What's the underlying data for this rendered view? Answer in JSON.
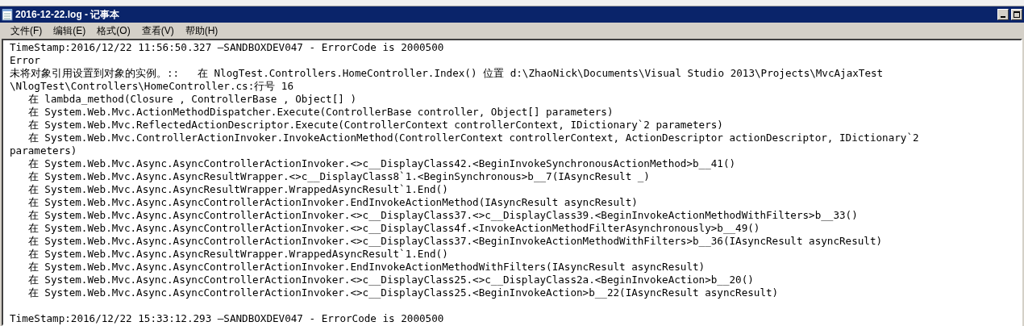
{
  "window": {
    "title": "2016-12-22.log - 记事本"
  },
  "menu": [
    "文件(F)",
    "编辑(E)",
    "格式(O)",
    "查看(V)",
    "帮助(H)"
  ],
  "log_entries": [
    {
      "lines": [
        "TimeStamp:2016/12/22 11:56:50.327 —SANDBOXDEV047 - ErrorCode is 2000500",
        "Error",
        "未将对象引用设置到对象的实例。::   在 NlogTest.Controllers.HomeController.Index() 位置 d:\\ZhaoNick\\Documents\\Visual Studio 2013\\Projects\\MvcAjaxTest",
        "\\NlogTest\\Controllers\\HomeController.cs:行号 16",
        "   在 lambda_method(Closure , ControllerBase , Object[] )",
        "   在 System.Web.Mvc.ActionMethodDispatcher.Execute(ControllerBase controller, Object[] parameters)",
        "   在 System.Web.Mvc.ReflectedActionDescriptor.Execute(ControllerContext controllerContext, IDictionary`2 parameters)",
        "   在 System.Web.Mvc.ControllerActionInvoker.InvokeActionMethod(ControllerContext controllerContext, ActionDescriptor actionDescriptor, IDictionary`2",
        "parameters)",
        "   在 System.Web.Mvc.Async.AsyncControllerActionInvoker.<>c__DisplayClass42.<BeginInvokeSynchronousActionMethod>b__41()",
        "   在 System.Web.Mvc.Async.AsyncResultWrapper.<>c__DisplayClass8`1.<BeginSynchronous>b__7(IAsyncResult _)",
        "   在 System.Web.Mvc.Async.AsyncResultWrapper.WrappedAsyncResult`1.End()",
        "   在 System.Web.Mvc.Async.AsyncControllerActionInvoker.EndInvokeActionMethod(IAsyncResult asyncResult)",
        "   在 System.Web.Mvc.Async.AsyncControllerActionInvoker.<>c__DisplayClass37.<>c__DisplayClass39.<BeginInvokeActionMethodWithFilters>b__33()",
        "   在 System.Web.Mvc.Async.AsyncControllerActionInvoker.<>c__DisplayClass4f.<InvokeActionMethodFilterAsynchronously>b__49()",
        "   在 System.Web.Mvc.Async.AsyncControllerActionInvoker.<>c__DisplayClass37.<BeginInvokeActionMethodWithFilters>b__36(IAsyncResult asyncResult)",
        "   在 System.Web.Mvc.Async.AsyncResultWrapper.WrappedAsyncResult`1.End()",
        "   在 System.Web.Mvc.Async.AsyncControllerActionInvoker.EndInvokeActionMethodWithFilters(IAsyncResult asyncResult)",
        "   在 System.Web.Mvc.Async.AsyncControllerActionInvoker.<>c__DisplayClass25.<>c__DisplayClass2a.<BeginInvokeAction>b__20()",
        "   在 System.Web.Mvc.Async.AsyncControllerActionInvoker.<>c__DisplayClass25.<BeginInvokeAction>b__22(IAsyncResult asyncResult)"
      ]
    },
    {
      "lines": [
        "TimeStamp:2016/12/22 15:33:12.293 —SANDBOXDEV047 - ErrorCode is 2000500"
      ]
    }
  ]
}
